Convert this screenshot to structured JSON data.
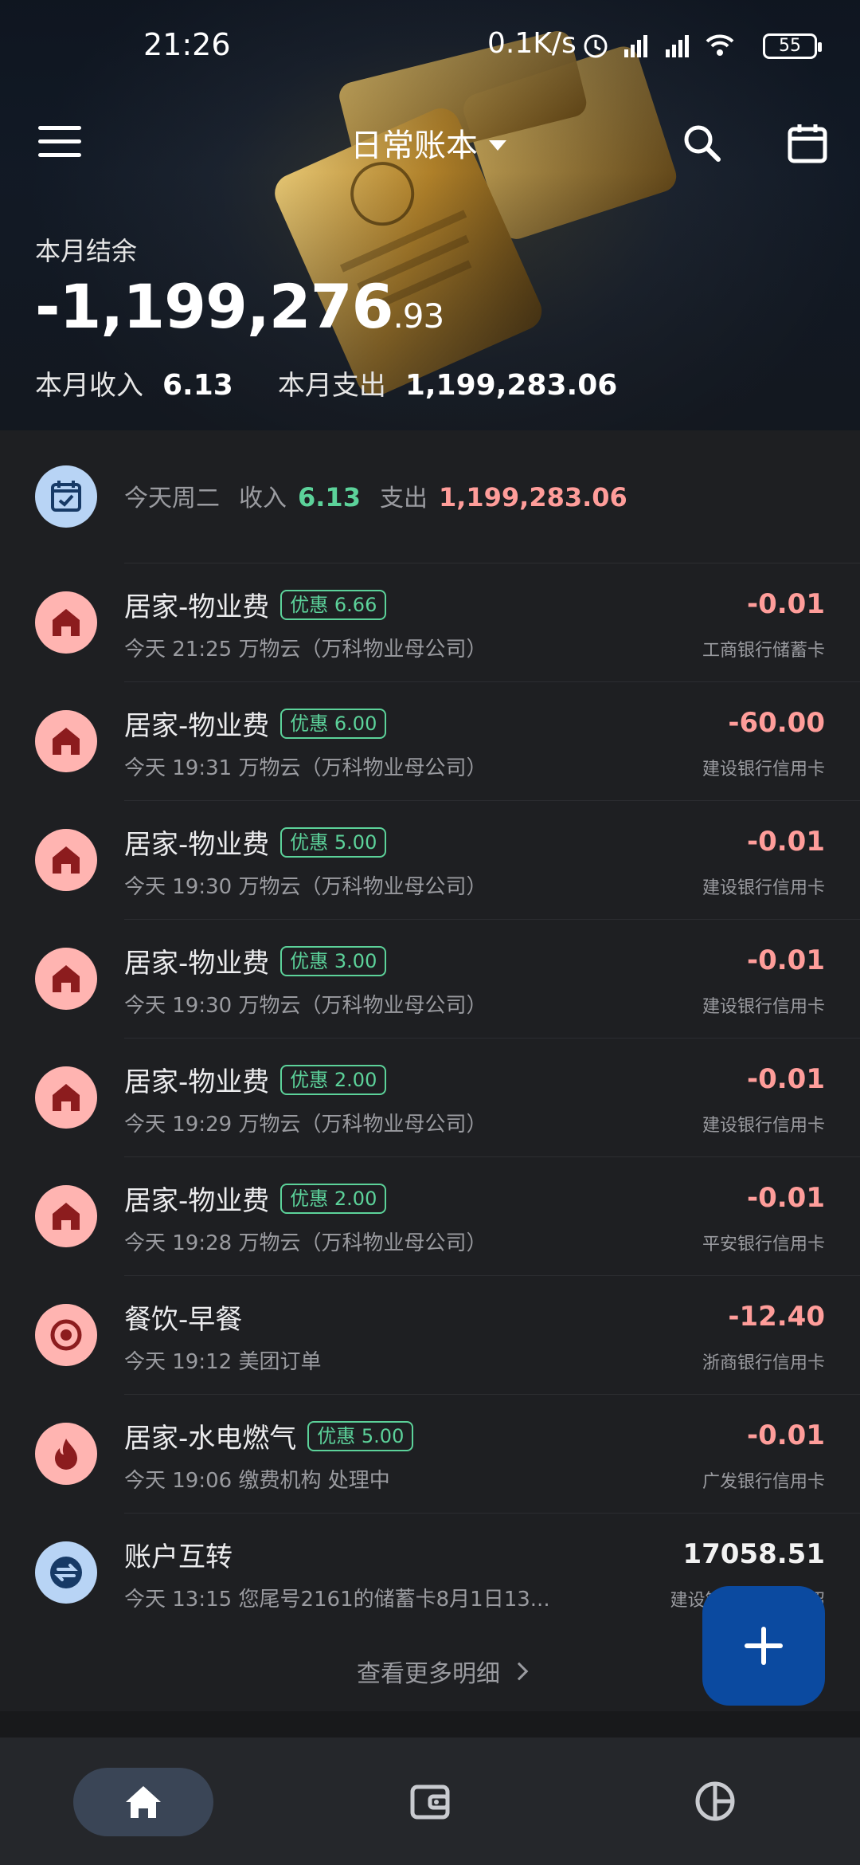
{
  "status": {
    "time": "21:26",
    "network": "0.1K/s",
    "battery": "55"
  },
  "header": {
    "book_title": "日常账本"
  },
  "summary": {
    "balance_label": "本月结余",
    "balance_int": "-1,199,276",
    "balance_dec": ".93",
    "income_label": "本月收入",
    "income": "6.13",
    "expense_label": "本月支出",
    "expense": "1,199,283.06"
  },
  "today": {
    "day": "今天周二",
    "income_label": "收入",
    "income": "6.13",
    "expense_label": "支出",
    "expense": "1,199,283.06"
  },
  "transactions": [
    {
      "category": "居家-物业费",
      "badge": "优惠 6.66",
      "detail": "今天 21:25 万物云（万科物业母公司）",
      "amount": "-0.01",
      "account": "工商银行储蓄卡",
      "icon": "house-icon"
    },
    {
      "category": "居家-物业费",
      "badge": "优惠 6.00",
      "detail": "今天 19:31 万物云（万科物业母公司）",
      "amount": "-60.00",
      "account": "建设银行信用卡",
      "icon": "house-icon"
    },
    {
      "category": "居家-物业费",
      "badge": "优惠 5.00",
      "detail": "今天 19:30 万物云（万科物业母公司）",
      "amount": "-0.01",
      "account": "建设银行信用卡",
      "icon": "house-icon"
    },
    {
      "category": "居家-物业费",
      "badge": "优惠 3.00",
      "detail": "今天 19:30 万物云（万科物业母公司）",
      "amount": "-0.01",
      "account": "建设银行信用卡",
      "icon": "house-icon"
    },
    {
      "category": "居家-物业费",
      "badge": "优惠 2.00",
      "detail": "今天 19:29 万物云（万科物业母公司）",
      "amount": "-0.01",
      "account": "建设银行信用卡",
      "icon": "house-icon"
    },
    {
      "category": "居家-物业费",
      "badge": "优惠 2.00",
      "detail": "今天 19:28 万物云（万科物业母公司）",
      "amount": "-0.01",
      "account": "平安银行信用卡",
      "icon": "house-icon"
    },
    {
      "category": "餐饮-早餐",
      "badge": "",
      "detail": "今天 19:12 美团订单",
      "amount": "-12.40",
      "account": "浙商银行信用卡",
      "icon": "egg-icon"
    },
    {
      "category": "居家-水电燃气",
      "badge": "优惠 5.00",
      "detail": "今天 19:06 缴费机构 处理中",
      "amount": "-0.01",
      "account": "广发银行信用卡",
      "icon": "flame-icon"
    },
    {
      "category": "账户互转",
      "badge": "",
      "detail": "今天 13:15 您尾号2161的储蓄卡8月1日13...",
      "amount": "17058.51",
      "account": "建设银行储蓄卡→招",
      "icon": "transfer-icon"
    }
  ],
  "more_label": "查看更多明细",
  "colors": {
    "income": "#5cd29a",
    "expense": "#ff9d9a",
    "fab": "#0b4aa0",
    "nav_active": "#3a4556"
  }
}
